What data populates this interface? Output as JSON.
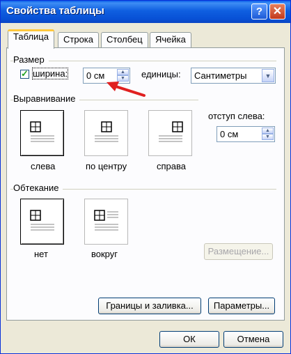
{
  "window": {
    "title": "Свойства таблицы",
    "help_glyph": "?",
    "close_glyph": "✕"
  },
  "tabs": [
    {
      "label": "Таблица"
    },
    {
      "label": "Строка"
    },
    {
      "label": "Столбец"
    },
    {
      "label": "Ячейка"
    }
  ],
  "size_group": {
    "label": "Размер",
    "width_label": "ширина:",
    "width_value": "0 см",
    "units_label": "единицы:",
    "units_value": "Сантиметры"
  },
  "align_group": {
    "label": "Выравнивание",
    "options": [
      {
        "label": "слева"
      },
      {
        "label": "по центру"
      },
      {
        "label": "справа"
      }
    ],
    "indent_label": "отступ слева:",
    "indent_value": "0 см"
  },
  "wrap_group": {
    "label": "Обтекание",
    "options": [
      {
        "label": "нет"
      },
      {
        "label": "вокруг"
      }
    ],
    "position_button": "Размещение..."
  },
  "buttons": {
    "borders": "Границы и заливка...",
    "options": "Параметры...",
    "ok": "ОК",
    "cancel": "Отмена"
  },
  "colors": {
    "titlebar": "#0a5ee9",
    "arrow": "#e02020"
  }
}
